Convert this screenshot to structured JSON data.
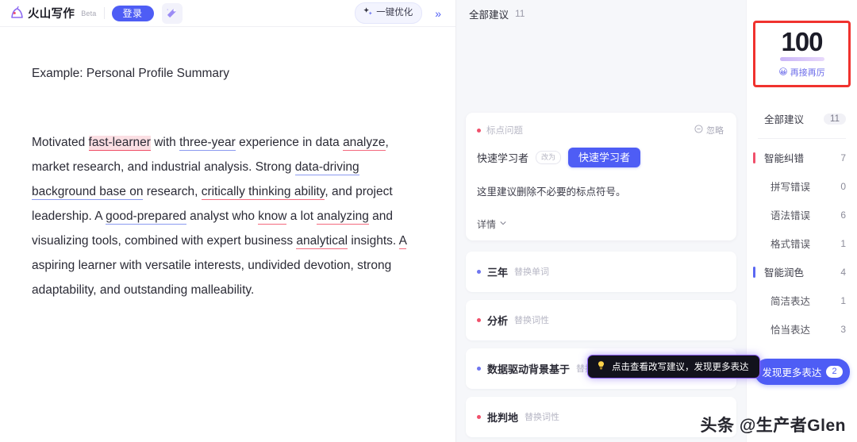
{
  "header": {
    "brand_name": "火山写作",
    "beta_label": "Beta",
    "login_label": "登录",
    "magic_icon": "magic-wand-icon",
    "optimize_label": "一键优化",
    "optimize_icon": "sparkle-icon",
    "expand_icon": "»"
  },
  "document": {
    "title": "Example: Personal Profile Summary",
    "paragraph_runs": [
      {
        "text": "Motivated ",
        "style": "plain"
      },
      {
        "text": "fast-learner",
        "style": "red-highlight"
      },
      {
        "text": " with ",
        "style": "plain"
      },
      {
        "text": "three-year",
        "style": "blue"
      },
      {
        "text": " experience in data ",
        "style": "plain"
      },
      {
        "text": "analyze",
        "style": "red"
      },
      {
        "text": ", market research, and industrial analysis. Strong ",
        "style": "plain"
      },
      {
        "text": "data-driving background base on",
        "style": "blue"
      },
      {
        "text": " research, ",
        "style": "plain"
      },
      {
        "text": "critically thinking ability",
        "style": "red"
      },
      {
        "text": ", and project leadership. A ",
        "style": "plain"
      },
      {
        "text": "good-prepared",
        "style": "blue"
      },
      {
        "text": " analyst who ",
        "style": "plain"
      },
      {
        "text": "know",
        "style": "red"
      },
      {
        "text": " a lot ",
        "style": "plain"
      },
      {
        "text": "analyzing",
        "style": "red"
      },
      {
        "text": " and visualizing tools, combined with expert business ",
        "style": "plain"
      },
      {
        "text": "analytical",
        "style": "red"
      },
      {
        "text": " insights. ",
        "style": "plain"
      },
      {
        "text": "A",
        "style": "red"
      },
      {
        "text": " aspiring learner with versatile interests, undivided devotion, strong adaptability, and outstanding malleability.",
        "style": "plain"
      }
    ]
  },
  "suggestions_panel": {
    "header_label": "全部建议",
    "header_count": "11",
    "card": {
      "tag": "标点问题",
      "ignore_label": "忽略",
      "ignore_icon": "minus-circle-icon",
      "original_word": "快速学习者",
      "arrow_label": "改为",
      "new_word": "快速学习者",
      "description": "这里建议删除不必要的标点符号。",
      "more_label": "详情",
      "more_icon": "chevron-down-icon"
    },
    "rows": [
      {
        "word": "三年",
        "action": "替换单词",
        "dot": "blue"
      },
      {
        "word": "分析",
        "action": "替换词性",
        "dot": "red"
      },
      {
        "word": "数据驱动背景基于",
        "action": "替换",
        "dot": "blue"
      },
      {
        "word": "批判地",
        "action": "替换词性",
        "dot": "red"
      }
    ]
  },
  "nav_panel": {
    "score": "100",
    "score_caption": "再接再厉",
    "score_emoji": "😀",
    "all_label": "全部建议",
    "all_count": "11",
    "groups": [
      {
        "label": "智能纠错",
        "count": "7",
        "bar": "red",
        "items": [
          {
            "label": "拼写错误",
            "count": "0"
          },
          {
            "label": "语法错误",
            "count": "6"
          },
          {
            "label": "格式错误",
            "count": "1"
          }
        ]
      },
      {
        "label": "智能润色",
        "count": "4",
        "bar": "blue",
        "items": [
          {
            "label": "简洁表达",
            "count": "1"
          },
          {
            "label": "恰当表达",
            "count": "3"
          }
        ]
      }
    ],
    "discover_label": "发现更多表达",
    "discover_count": "2"
  },
  "tooltip": {
    "icon": "lightbulb-icon",
    "text": "点击查看改写建议，发现更多表达"
  },
  "watermark": {
    "text": "头条 @生产者Glen"
  },
  "colors": {
    "accent": "#4e5df5",
    "error": "#f0506b",
    "polish": "#5b68f2",
    "highlight_border": "#f0322e"
  }
}
